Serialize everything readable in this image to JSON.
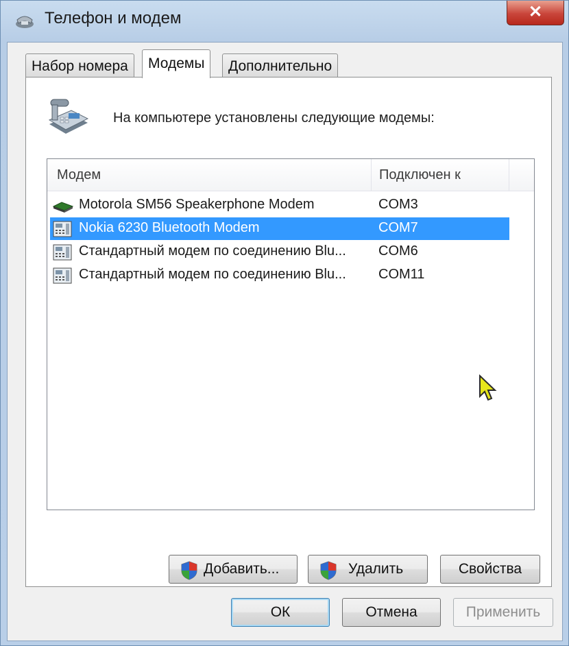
{
  "window": {
    "title": "Телефон и модем",
    "close_glyph": "✕"
  },
  "tabs": [
    {
      "label": "Набор номера",
      "active": false
    },
    {
      "label": "Модемы",
      "active": true
    },
    {
      "label": "Дополнительно",
      "active": false
    }
  ],
  "panel": {
    "description": "На компьютере установлены следующие модемы:",
    "icon": "telephone-modem-icon"
  },
  "modem_list": {
    "columns": [
      "Модем",
      "Подключен к"
    ],
    "rows": [
      {
        "name": "Motorola SM56 Speakerphone Modem",
        "port": "COM3",
        "icon": "modem-card-icon",
        "selected": false
      },
      {
        "name": "Nokia 6230 Bluetooth Modem",
        "port": "COM7",
        "icon": "modem-phone-icon",
        "selected": true
      },
      {
        "name": "Стандартный модем по соединению Blu...",
        "port": "COM6",
        "icon": "modem-phone-icon",
        "selected": false
      },
      {
        "name": "Стандартный модем по соединению Blu...",
        "port": "COM11",
        "icon": "modem-phone-icon",
        "selected": false
      }
    ]
  },
  "panel_buttons": {
    "add": "Добавить...",
    "remove": "Удалить",
    "properties": "Свойства"
  },
  "dialog_buttons": {
    "ok": "ОК",
    "cancel": "Отмена",
    "apply": "Применить"
  },
  "colors": {
    "selection": "#3399ff",
    "window_frame": "#b9cfe8",
    "close_button": "#c9453a"
  }
}
